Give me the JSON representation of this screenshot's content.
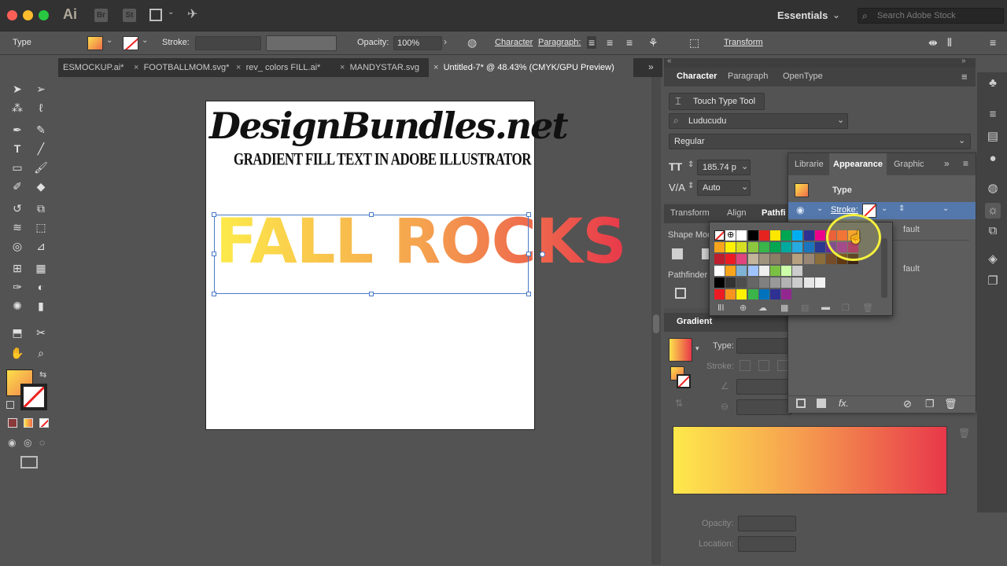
{
  "app": {
    "logo": "Ai",
    "bridge": "Br",
    "stock": "St",
    "workspace": "Essentials",
    "search_placeholder": "Search Adobe Stock"
  },
  "control": {
    "selection": "Type",
    "stroke_label": "Stroke:",
    "opacity_label": "Opacity:",
    "opacity_value": "100%",
    "character_link": "Character",
    "paragraph_link": "Paragraph:",
    "transform_link": "Transform"
  },
  "tabs": [
    {
      "label": "ESMOCKUP.ai*"
    },
    {
      "label": "FOOTBALLMOM.svg*"
    },
    {
      "label": "rev_ colors FILL.ai*"
    },
    {
      "label": "MANDYSTAR.svg"
    },
    {
      "label": "Untitled-7* @ 48.43% (CMYK/GPU Preview)"
    }
  ],
  "artboard": {
    "headline": "DesignBundles.net",
    "subtitle": "GRADIENT FILL TEXT IN ADOBE ILLUSTRATOR",
    "art_text": "FALL ROCKS"
  },
  "character": {
    "tabs": [
      "Character",
      "Paragraph",
      "OpenType"
    ],
    "touch_type": "Touch Type Tool",
    "font_family": "Luducudu",
    "font_style": "Regular",
    "font_size": "185.74 p",
    "leading": "Auto"
  },
  "mid": {
    "tabs": [
      "Transform",
      "Align",
      "Pathfi"
    ],
    "shape_modes": "Shape Mod",
    "pathfinders": "Pathfinder"
  },
  "appearance": {
    "tabs": [
      "Librarie",
      "Appearance",
      "Graphic"
    ],
    "type_label": "Type",
    "stroke_label": "Stroke:",
    "row_default_1": "fault",
    "row_default_2": "fault",
    "fx": "fx."
  },
  "gradient": {
    "title": "Gradient",
    "type_label": "Type:",
    "stroke_label": "Stroke:",
    "opacity_label": "Opacity:",
    "location_label": "Location:"
  },
  "colors": {
    "accent": "#4a7ac7",
    "gradient_start": "#fee94b",
    "gradient_mid": "#f6a04f",
    "gradient_end": "#e8384a"
  },
  "icons": [
    "selection-icon",
    "direct-selection-icon",
    "magic-wand-icon",
    "lasso-icon",
    "pen-icon",
    "curvature-icon",
    "type-icon",
    "line-icon",
    "rectangle-icon",
    "paintbrush-icon",
    "shaper-icon",
    "eraser-icon",
    "rotate-icon",
    "scale-icon",
    "warp-icon",
    "free-transform-icon",
    "shape-builder-icon",
    "perspective-icon",
    "mesh-icon",
    "gradient-icon",
    "eyedropper-icon",
    "blend-icon",
    "symbol-sprayer-icon",
    "graph-icon",
    "artboard-icon",
    "slice-icon",
    "hand-icon",
    "zoom-icon"
  ]
}
